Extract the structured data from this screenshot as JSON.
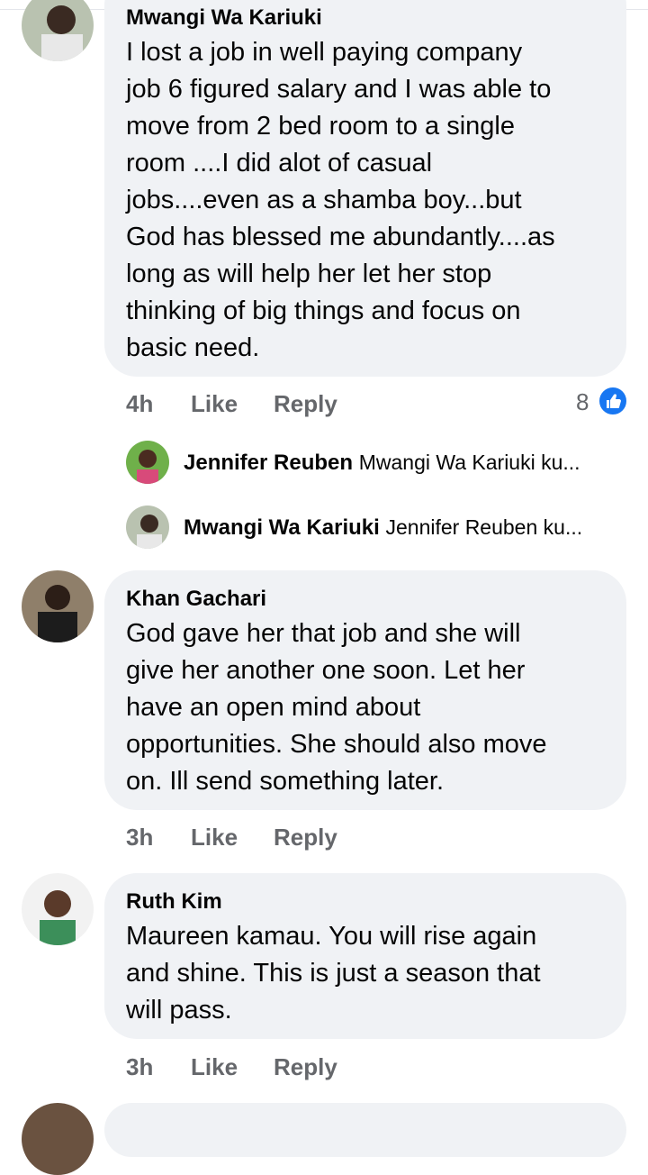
{
  "comments": [
    {
      "author": "Mwangi Wa Kariuki",
      "text": "I lost  a job in  well paying company\njob 6 figured salary and I was able to\nmove from 2 bed room to a single\nroom ....I did alot of casual\njobs....even as a shamba boy...but\nGod has blessed me abundantly....as\nlong as will help her let her stop\nthinking of big things and focus on\nbasic need.",
      "time": "4h",
      "like_label": "Like",
      "reply_label": "Reply",
      "reaction_count": "8",
      "replies": [
        {
          "name": "Jennifer Reuben",
          "preview": "Mwangi Wa Kariuki ku..."
        },
        {
          "name": "Mwangi Wa Kariuki",
          "preview": "Jennifer Reuben ku..."
        }
      ]
    },
    {
      "author": "Khan Gachari",
      "text": "God gave her that job and she will\ngive her another one soon. Let her\nhave an open mind about\nopportunities. She should also move\non. Ill send something later.",
      "time": "3h",
      "like_label": "Like",
      "reply_label": "Reply"
    },
    {
      "author": "Ruth Kim",
      "text": "Maureen kamau. You will rise again\nand shine. This is just a season that\nwill pass.",
      "time": "3h",
      "like_label": "Like",
      "reply_label": "Reply"
    }
  ],
  "colors": {
    "bubble": "#f0f2f5",
    "meta": "#65676b",
    "like_blue": "#1877f2"
  }
}
